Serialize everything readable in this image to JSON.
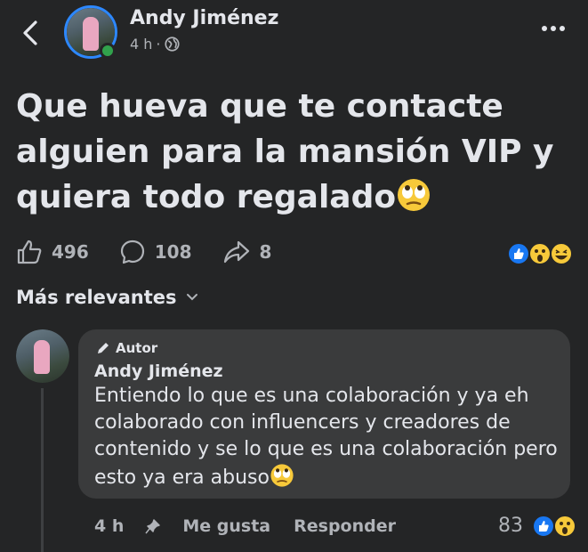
{
  "header": {
    "author_name": "Andy Jiménez",
    "time": "4 h",
    "separator": "·",
    "icons": {
      "back": "chevron-left-icon",
      "privacy": "globe-icon",
      "more": "more-horizontal-icon"
    }
  },
  "post": {
    "text": "Que hueva que te contacte alguien para la mansión VIP y quiera todo regalado",
    "emoji": "face-with-rolling-eyes"
  },
  "stats": {
    "likes": "496",
    "comments": "108",
    "shares": "8",
    "reactions": [
      "like",
      "wow",
      "haha"
    ]
  },
  "comments_sort": {
    "label": "Más relevantes"
  },
  "comment": {
    "badge": "Autor",
    "author": "Andy Jiménez",
    "text": "Entiendo lo que es una colaboración y ya eh colaborado con influencers y creadores de contenido y se lo que es una colaboración pero esto ya era abuso",
    "emoji": "face-with-rolling-eyes",
    "time": "4 h",
    "like_label": "Me gusta",
    "reply_label": "Responder",
    "reaction_count": "83",
    "reactions": [
      "like",
      "wow"
    ]
  },
  "colors": {
    "background": "#242526",
    "bubble": "#3a3b3c",
    "text_primary": "#e4e6eb",
    "text_secondary": "#b0b3b8",
    "accent_blue": "#2d88ff",
    "online_green": "#31a24c"
  }
}
